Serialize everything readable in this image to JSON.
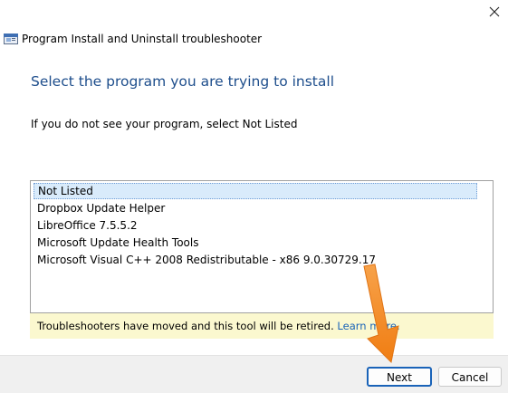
{
  "window": {
    "title": "Program Install and Uninstall troubleshooter",
    "close_glyph": "✕"
  },
  "main": {
    "heading": "Select the program you are trying to install",
    "instruction": "If you do not see your program, select Not Listed",
    "programs": [
      {
        "label": "Not Listed",
        "selected": true
      },
      {
        "label": "Dropbox Update Helper",
        "selected": false
      },
      {
        "label": "LibreOffice 7.5.5.2",
        "selected": false
      },
      {
        "label": "Microsoft Update Health Tools",
        "selected": false
      },
      {
        "label": "Microsoft Visual C++ 2008 Redistributable - x86 9.0.30729.17",
        "selected": false
      }
    ]
  },
  "notice": {
    "text": "Troubleshooters have moved and this tool will be retired.",
    "link": "Learn more."
  },
  "buttons": {
    "next": "Next",
    "cancel": "Cancel"
  },
  "colors": {
    "heading": "#1e4e8c",
    "selection": "#d9ebfb",
    "notice_bg": "#fbf8cf",
    "link": "#1a63b8",
    "annotation_arrow": "#f58a1f"
  },
  "icons": {
    "window": "troubleshooter-window-icon",
    "close": "close-icon",
    "annotation": "orange-arrow-annotation"
  }
}
